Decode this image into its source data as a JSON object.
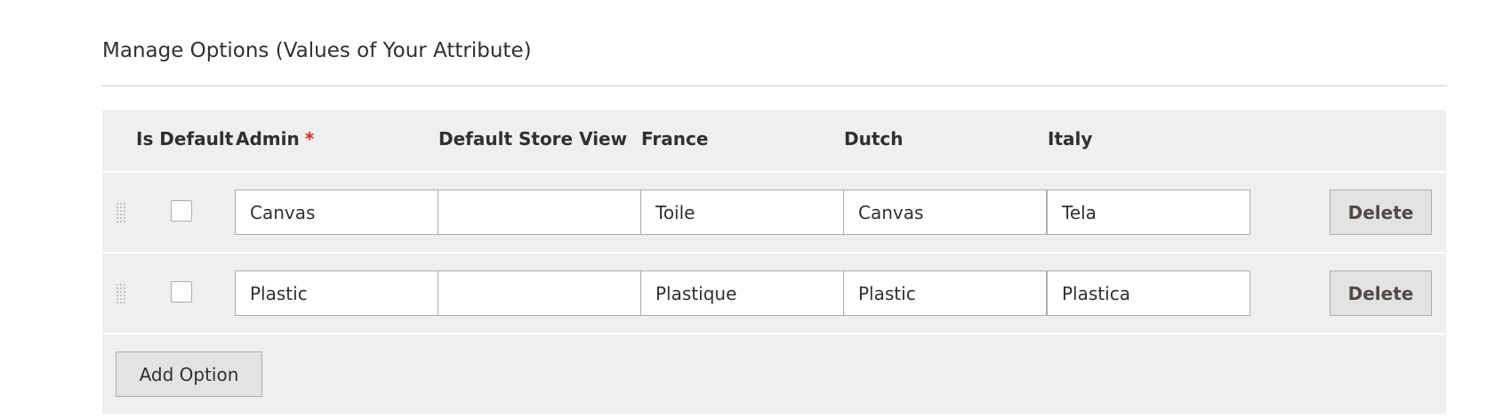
{
  "section": {
    "title": "Manage Options (Values of Your Attribute)"
  },
  "table": {
    "headers": {
      "is_default": "Is Default",
      "admin": "Admin",
      "admin_required_mark": "*",
      "default_store_view": "Default Store View",
      "france": "France",
      "dutch": "Dutch",
      "italy": "Italy"
    },
    "rows": [
      {
        "is_default": false,
        "admin": "Canvas",
        "default_store_view": "",
        "france": "Toile",
        "dutch": "Canvas",
        "italy": "Tela",
        "delete_label": "Delete"
      },
      {
        "is_default": false,
        "admin": "Plastic",
        "default_store_view": "",
        "france": "Plastique",
        "dutch": "Plastic",
        "italy": "Plastica",
        "delete_label": "Delete"
      }
    ],
    "add_option_label": "Add Option"
  },
  "icons": {
    "drag_handle": "drag-handle-icon"
  },
  "colors": {
    "required": "#e22626",
    "table_background": "#efefef",
    "button_background": "#e3e3e3",
    "border": "#adadad"
  }
}
